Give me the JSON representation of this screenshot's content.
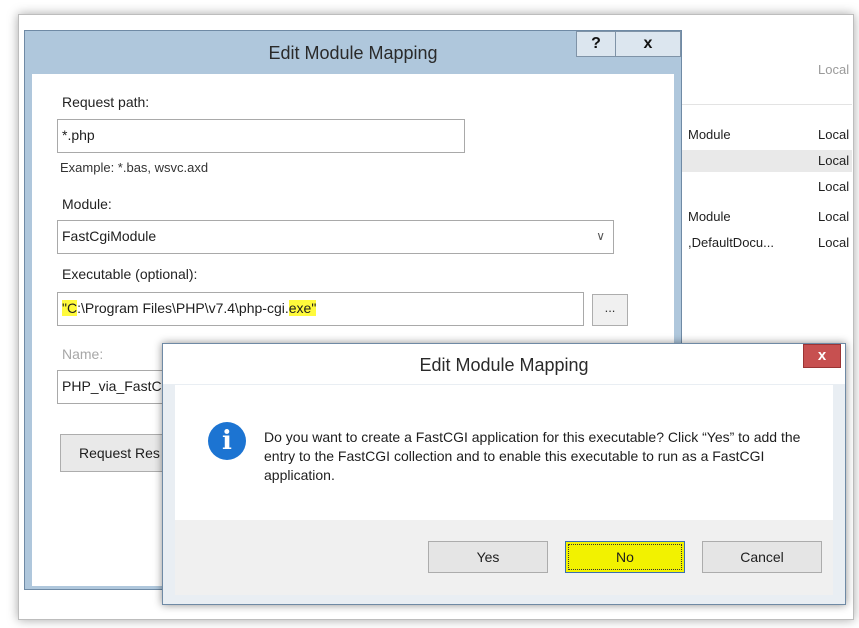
{
  "background_list": {
    "header_col2": "Local",
    "rows": [
      {
        "col1": "Module",
        "col2": "Local"
      },
      {
        "col1": "",
        "col2": "Local"
      },
      {
        "col1": "",
        "col2": "Local"
      },
      {
        "col1": "Module",
        "col2": "Local"
      },
      {
        "col1": ",DefaultDocu...",
        "col2": "Local"
      }
    ]
  },
  "main_dialog": {
    "title": "Edit Module Mapping",
    "help_label": "?",
    "close_label": "x",
    "request_path_label": "Request path:",
    "request_path_value": "*.php",
    "example_text": "Example: *.bas, wsvc.axd",
    "module_label": "Module:",
    "module_value": "FastCgiModule",
    "executable_label": "Executable (optional):",
    "executable_value": {
      "q1": "\"",
      "start": "C",
      "mid": ":\\Program Files\\PHP\\v7.4\\php-cgi.",
      "end": "exe\""
    },
    "browse_label": "...",
    "name_label": "Name:",
    "name_value": "PHP_via_FastC",
    "request_restrictions_label": "Request Res"
  },
  "confirm_dialog": {
    "title": "Edit Module Mapping",
    "close_label": "x",
    "message": "Do you want to create a FastCGI application for this executable? Click “Yes” to add the entry to the FastCGI collection and to enable this executable to run as a FastCGI application.",
    "buttons": {
      "yes": "Yes",
      "no": "No",
      "cancel": "Cancel"
    }
  },
  "colors": {
    "highlight": "#fffa3c",
    "focused_button": "#f2f200",
    "info_icon": "#1c74d2",
    "close_button": "#c75050"
  },
  "icons": {
    "info": "info-icon",
    "dropdown": "chevron-down-icon"
  }
}
